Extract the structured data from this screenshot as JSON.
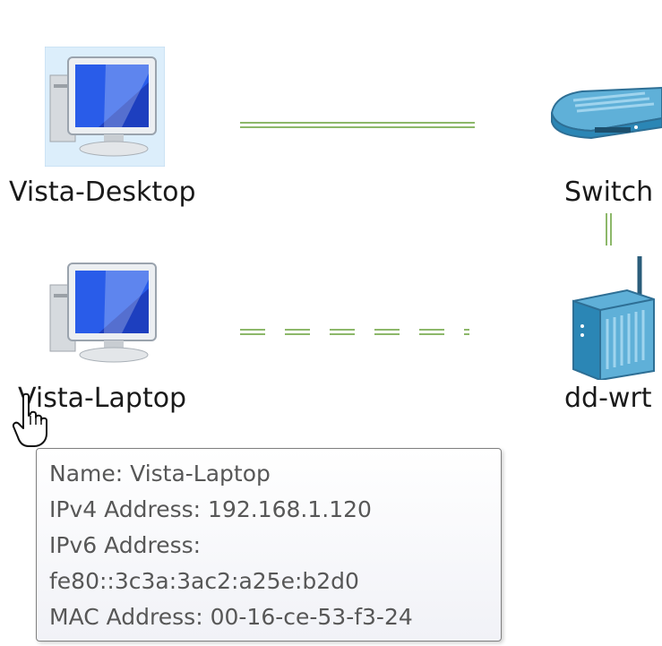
{
  "devices": {
    "vista_desktop": {
      "label": "Vista-Desktop",
      "icon": "computer-icon",
      "selected": true
    },
    "vista_laptop": {
      "label": "Vista-Laptop",
      "icon": "computer-icon",
      "selected": false
    },
    "switch": {
      "label": "Switch",
      "icon": "switch-icon"
    },
    "router": {
      "label": "dd-wrt",
      "icon": "wireless-router-icon"
    }
  },
  "links": [
    {
      "from": "Vista-Desktop",
      "to": "Switch",
      "style": "solid-wired"
    },
    {
      "from": "Vista-Laptop",
      "to": "dd-wrt",
      "style": "dashed-wireless"
    },
    {
      "from": "Switch",
      "to": "dd-wrt",
      "style": "solid-wired"
    }
  ],
  "tooltip": {
    "name_label": "Name:",
    "name_value": "Vista-Laptop",
    "ipv4_label": "IPv4 Address:",
    "ipv4_value": "192.168.1.120",
    "ipv6_label": "IPv6 Address:",
    "ipv6_value": "fe80::3c3a:3ac2:a25e:b2d0",
    "mac_label": "MAC Address:",
    "mac_value": "00-16-ce-53-f3-24"
  },
  "cursor": "hand-pointer-icon",
  "colors": {
    "link_green": "#8db86a",
    "selection_bg": "#dceefb",
    "tooltip_text": "#575757"
  }
}
